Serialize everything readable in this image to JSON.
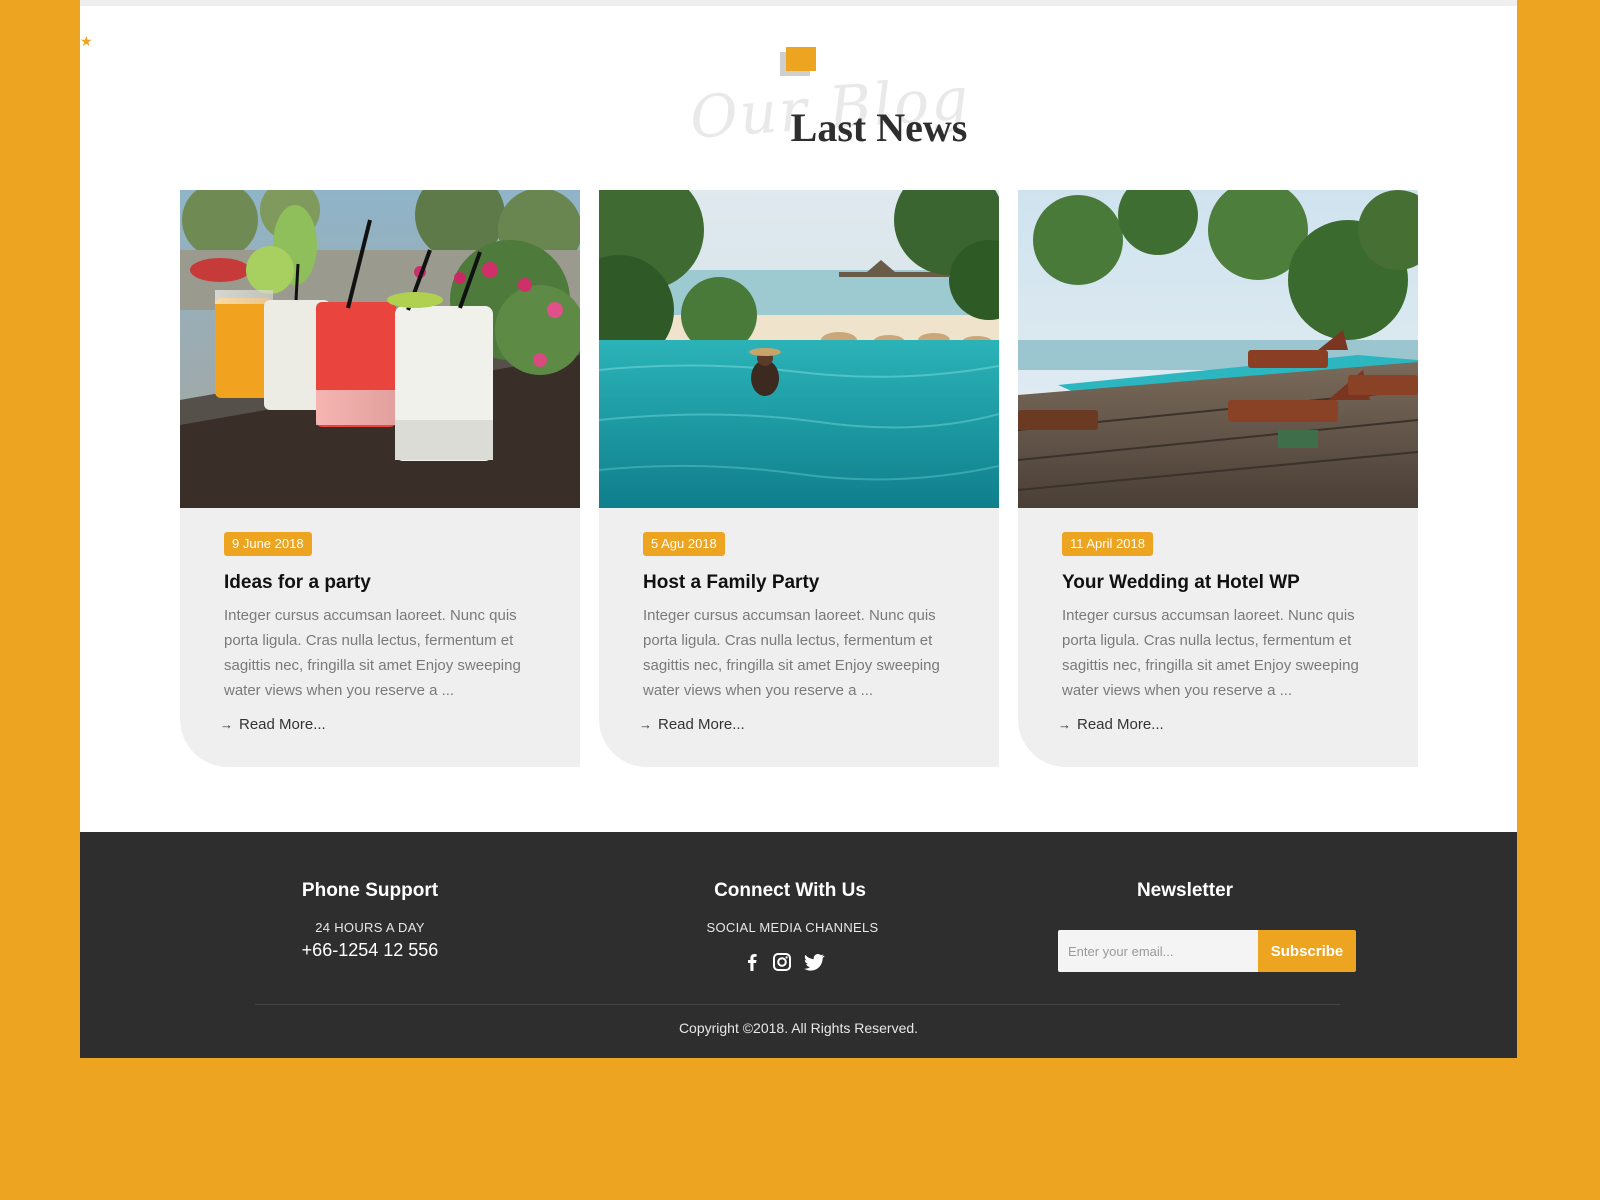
{
  "section": {
    "script_text": "Our Blog",
    "title": "Last News"
  },
  "posts": [
    {
      "date": "9 June 2018",
      "title": "Ideas for a party",
      "excerpt": "Integer cursus accumsan laoreet. Nunc quis porta ligula. Cras nulla lectus, fermentum et sagittis nec, fringilla sit amet Enjoy sweeping water views when you reserve a ...",
      "read_more": "Read More...",
      "image": "cocktail-glasses-photo"
    },
    {
      "date": "5 Agu 2018",
      "title": "Host a Family Party",
      "excerpt": "Integer cursus accumsan laoreet. Nunc quis porta ligula. Cras nulla lectus, fermentum et sagittis nec, fringilla sit amet Enjoy sweeping water views when you reserve a ...",
      "read_more": "Read More...",
      "image": "infinity-pool-photo"
    },
    {
      "date": "11 April 2018",
      "title": "Your Wedding at Hotel WP",
      "excerpt": "Integer cursus accumsan laoreet. Nunc quis porta ligula. Cras nulla lectus, fermentum et sagittis nec, fringilla sit amet Enjoy sweeping water views when you reserve a ...",
      "read_more": "Read More...",
      "image": "pool-deck-photo"
    }
  ],
  "footer": {
    "phone_heading": "Phone Support",
    "phone_caption": "24 HOURS A DAY",
    "phone_number": "+66-1254 12 556",
    "connect_heading": "Connect With Us",
    "connect_caption": "SOCIAL MEDIA CHANNELS",
    "socials": [
      "facebook-icon",
      "instagram-icon",
      "twitter-icon"
    ],
    "newsletter_heading": "Newsletter",
    "newsletter_placeholder": "Enter your email...",
    "subscribe_label": "Subscribe",
    "copyright": "Copyright ©2018. All Rights Reserved."
  },
  "colors": {
    "accent": "#EDA420",
    "footer_bg": "#2E2E2E",
    "card_bg": "#EFEFEF"
  }
}
